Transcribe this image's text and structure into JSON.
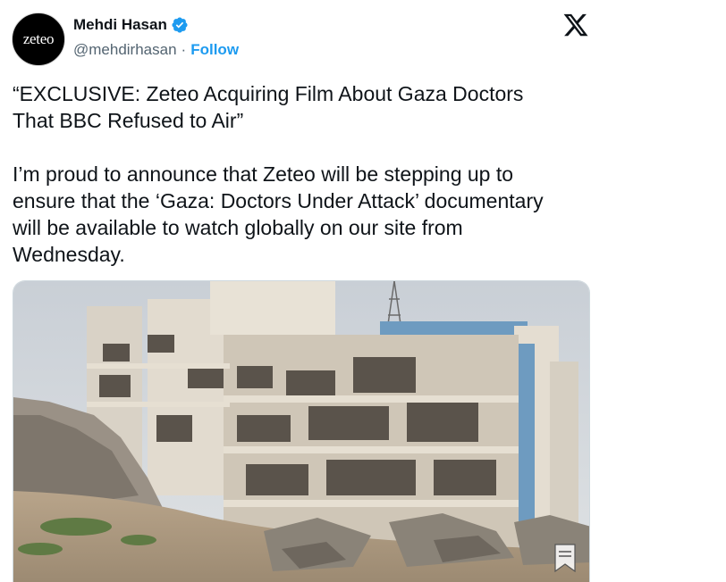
{
  "author": {
    "avatar_text": "zeteo",
    "display_name": "Mehdi Hasan",
    "handle": "@mehdirhasan",
    "separator": "·",
    "follow_label": "Follow",
    "verified": true
  },
  "tweet": {
    "text": "“EXCLUSIVE: Zeteo Acquiring Film About Gaza Doctors\nThat BBC Refused to Air”\n\nI’m proud to announce that Zeteo will be stepping up to\nensure that the ‘Gaza: Doctors Under Attack’ documentary\nwill be available to watch globally on our site from\nWednesday."
  },
  "media": {
    "description_icon": "bookmark-icon"
  },
  "colors": {
    "text_primary": "#0f1419",
    "text_secondary": "#536471",
    "accent_blue": "#1d9bf0"
  },
  "icons": {
    "verified": "verified-badge-icon",
    "platform": "x-logo-icon"
  }
}
